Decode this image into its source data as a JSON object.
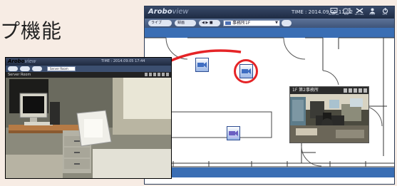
{
  "heading": "プ機能",
  "main_window": {
    "app_name_bold": "Arobo",
    "app_name_light": "view",
    "time": "TIME : 2014.09.05 11:02",
    "toolbar_icons": [
      {
        "name": "monitor-icon",
        "label": "MONITOR"
      },
      {
        "name": "map-icon",
        "label": "MAP"
      },
      {
        "name": "settings-icon",
        "label": "SETTING"
      },
      {
        "name": "user-icon",
        "label": "USER"
      },
      {
        "name": "power-icon",
        "label": "EXIT"
      }
    ],
    "toolbar": {
      "back_label": "ライブ",
      "next_label": "録画",
      "nav_label": "◀ ▶ ■",
      "floor_selector_value": "事務所1F"
    }
  },
  "popup": {
    "title": "1F 第2事務所"
  },
  "small_window": {
    "app_name_bold": "Arobo",
    "app_name_light": "view",
    "time": "TIME : 2014.09.05 17:44",
    "camera_title": "Server Room"
  },
  "colors": {
    "accent_red": "#e52427",
    "floor_strip_blue": "#3a6eb4",
    "titlebar_navy": "#1e2b43"
  }
}
